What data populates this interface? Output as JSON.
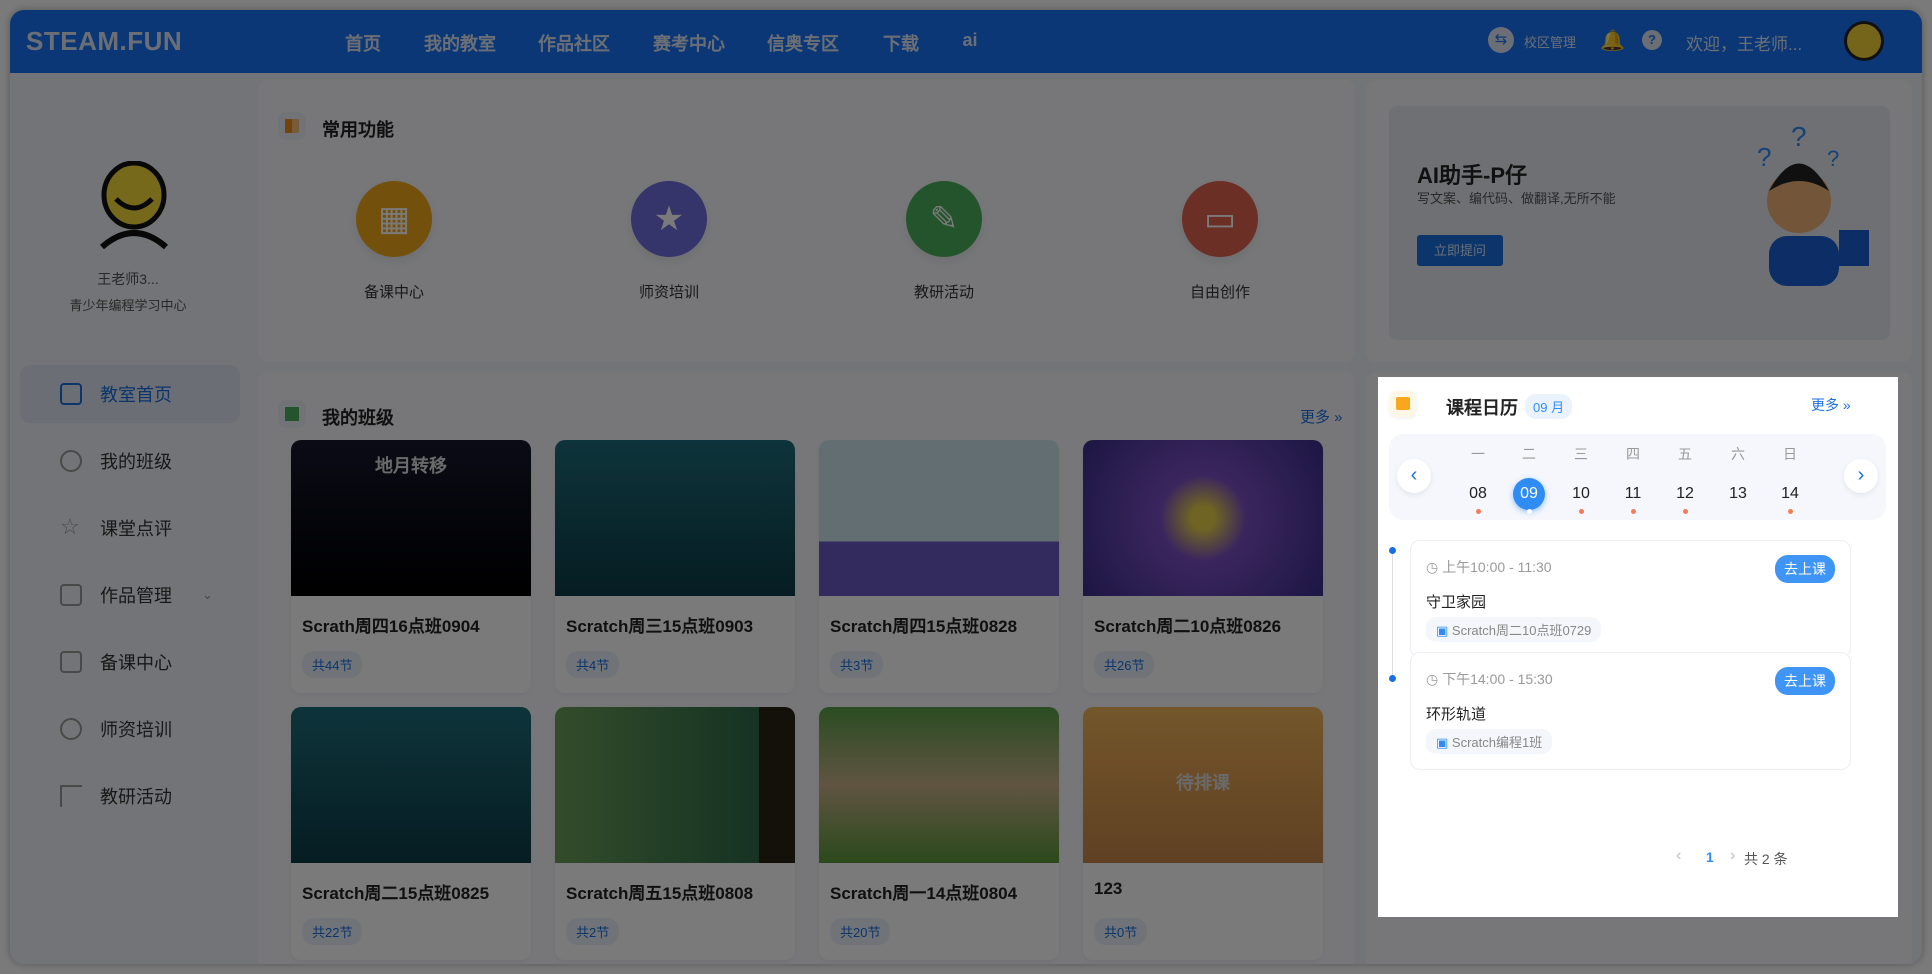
{
  "header": {
    "logo": "STEAM.FUN",
    "nav": [
      "首页",
      "我的教室",
      "作品社区",
      "赛考中心",
      "信奥专区",
      "下载",
      "ai"
    ],
    "campus": "校区管理",
    "welcome": "欢迎，王老师..."
  },
  "sidebar": {
    "user_name": "王老师3...",
    "org": "青少年编程学习中心",
    "items": [
      {
        "label": "教室首页",
        "active": true
      },
      {
        "label": "我的班级"
      },
      {
        "label": "课堂点评"
      },
      {
        "label": "作品管理"
      },
      {
        "label": "备课中心"
      },
      {
        "label": "师资培训"
      },
      {
        "label": "教研活动"
      }
    ]
  },
  "common": {
    "title": "常用功能",
    "items": [
      {
        "label": "备课中心",
        "color": "#f2a81d"
      },
      {
        "label": "师资培训",
        "color": "#6f6ee0"
      },
      {
        "label": "教研活动",
        "color": "#4cb05a"
      },
      {
        "label": "自由创作",
        "color": "#e0624f"
      }
    ]
  },
  "classes": {
    "title": "我的班级",
    "more": "更多 »",
    "items": [
      {
        "name": "Scrath周四16点班0904",
        "lessons": "共44节",
        "thumb_text": "地月转移"
      },
      {
        "name": "Scratch周三15点班0903",
        "lessons": "共4节"
      },
      {
        "name": "Scratch周四15点班0828",
        "lessons": "共3节"
      },
      {
        "name": "Scratch周二10点班0826",
        "lessons": "共26节"
      },
      {
        "name": "Scratch周二15点班0825",
        "lessons": "共22节"
      },
      {
        "name": "Scratch周五15点班0808",
        "lessons": "共2节"
      },
      {
        "name": "Scratch周一14点班0804",
        "lessons": "共20节"
      },
      {
        "name": "123",
        "lessons": "共0节",
        "thumb_text": "待排课"
      }
    ]
  },
  "ai": {
    "title": "AI助手-P仔",
    "subtitle": "写文案、编代码、做翻译,无所不能",
    "button": "立即提问"
  },
  "calendar": {
    "title": "课程日历",
    "month": "09 月",
    "more": "更多 »",
    "days": [
      {
        "w": "一",
        "d": "08",
        "dot": true
      },
      {
        "w": "二",
        "d": "09",
        "dot": true,
        "selected": true
      },
      {
        "w": "三",
        "d": "10",
        "dot": true
      },
      {
        "w": "四",
        "d": "11",
        "dot": true
      },
      {
        "w": "五",
        "d": "12",
        "dot": true
      },
      {
        "w": "六",
        "d": "13",
        "dot": false
      },
      {
        "w": "日",
        "d": "14",
        "dot": true
      }
    ],
    "events": [
      {
        "time": "上午10:00 - 11:30",
        "name": "守卫家园",
        "class": "Scratch周二10点班0729",
        "action": "去上课"
      },
      {
        "time": "下午14:00 - 15:30",
        "name": "环形轨道",
        "class": "Scratch编程1班",
        "action": "去上课"
      }
    ],
    "pagination": {
      "page": "1",
      "total": "共 2 条"
    }
  }
}
